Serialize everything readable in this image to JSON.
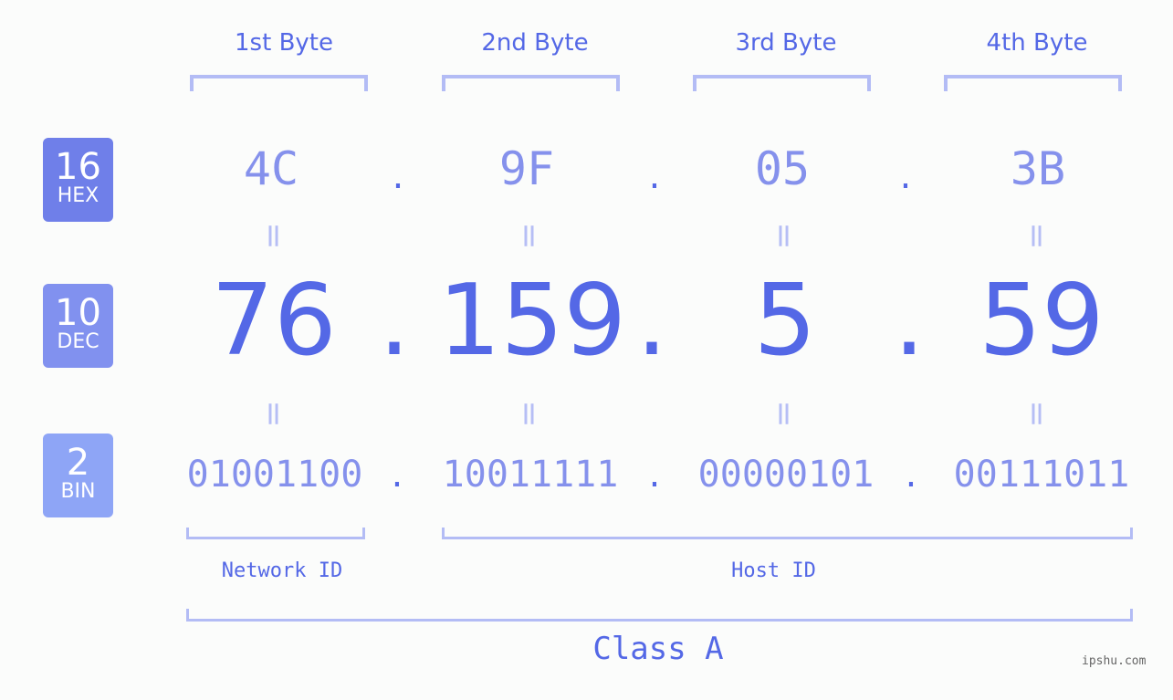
{
  "columns": [
    {
      "label": "1st Byte",
      "hex": "4C",
      "dec": "76",
      "bin": "01001100"
    },
    {
      "label": "2nd Byte",
      "hex": "9F",
      "dec": "159",
      "bin": "10011111"
    },
    {
      "label": "3rd Byte",
      "hex": "05",
      "dec": "5",
      "bin": "00000101"
    },
    {
      "label": "4th Byte",
      "hex": "3B",
      "dec": "59",
      "bin": "00111011"
    }
  ],
  "badges": {
    "hex": {
      "num": "16",
      "label": "HEX",
      "color": "#6f7fe9"
    },
    "dec": {
      "num": "10",
      "label": "DEC",
      "color": "#8191ef"
    },
    "bin": {
      "num": "2",
      "label": "BIN",
      "color": "#8ea5f6"
    }
  },
  "separator": ".",
  "equals": "=",
  "network_label": "Network ID",
  "host_label": "Host ID",
  "class_label": "Class A",
  "watermark": "ipshu.com",
  "colors": {
    "primary": "#5468e6",
    "light": "#8591ec",
    "bracket": "#b3bcf5",
    "background": "#fbfcfb"
  }
}
